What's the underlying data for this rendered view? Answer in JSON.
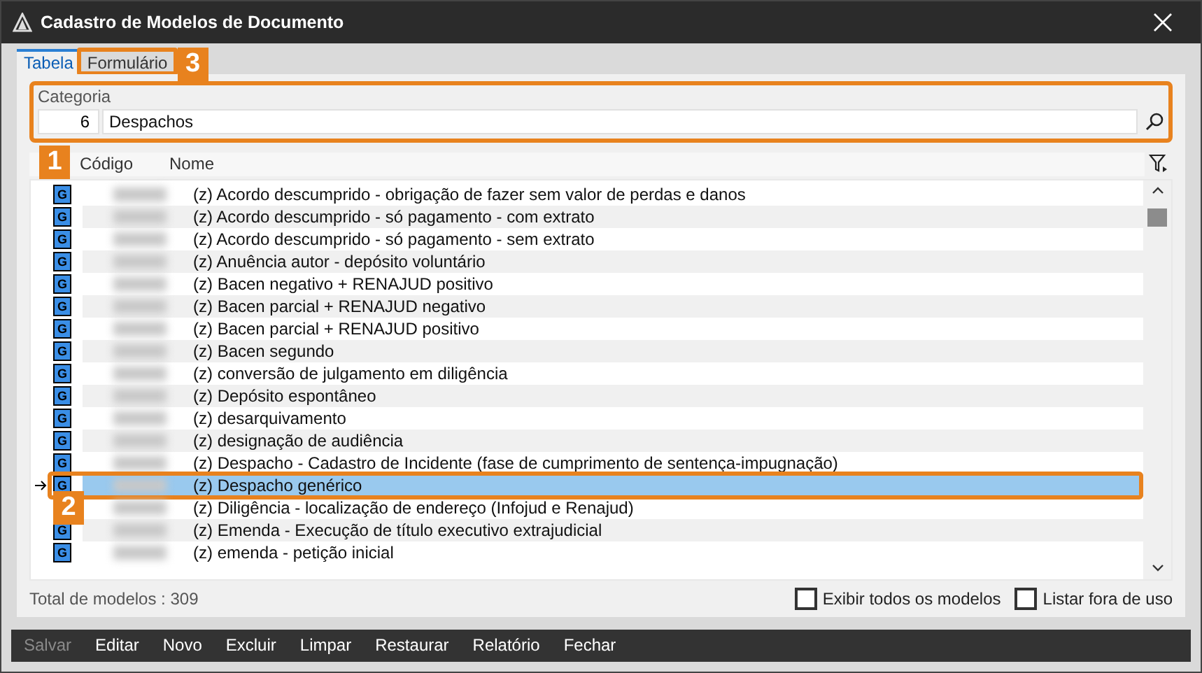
{
  "window": {
    "title": "Cadastro de Modelos de Documento"
  },
  "tabs": [
    {
      "label": "Tabela",
      "selected": true
    },
    {
      "label": "Formulário",
      "selected": false,
      "callout": "3"
    }
  ],
  "category": {
    "label": "Categoria",
    "code": "6",
    "value": "Despachos",
    "callout": "1"
  },
  "table": {
    "columns": [
      "Código",
      "Nome"
    ],
    "rows": [
      {
        "icon": "G",
        "name": "(z) Acordo descumprido - obrigação de fazer sem valor de perdas e danos",
        "selected": false
      },
      {
        "icon": "G",
        "name": "(z) Acordo descumprido - só pagamento - com extrato",
        "selected": false
      },
      {
        "icon": "G",
        "name": "(z) Acordo descumprido - só pagamento - sem extrato",
        "selected": false
      },
      {
        "icon": "G",
        "name": "(z) Anuência autor - depósito voluntário",
        "selected": false
      },
      {
        "icon": "G",
        "name": "(z) Bacen negativo + RENAJUD positivo",
        "selected": false
      },
      {
        "icon": "G",
        "name": "(z) Bacen parcial + RENAJUD negativo",
        "selected": false
      },
      {
        "icon": "G",
        "name": "(z) Bacen parcial + RENAJUD positivo",
        "selected": false
      },
      {
        "icon": "G",
        "name": "(z) Bacen segundo",
        "selected": false
      },
      {
        "icon": "G",
        "name": "(z) conversão de julgamento em diligência",
        "selected": false
      },
      {
        "icon": "G",
        "name": "(z) Depósito espontâneo",
        "selected": false
      },
      {
        "icon": "G",
        "name": "(z) desarquivamento",
        "selected": false
      },
      {
        "icon": "G",
        "name": "(z) designação de audiência",
        "selected": false
      },
      {
        "icon": "G",
        "name": "(z) Despacho - Cadastro de Incidente (fase de cumprimento de sentença-impugnação)",
        "selected": false
      },
      {
        "icon": "G",
        "name": "(z) Despacho genérico",
        "selected": true,
        "callout": "2"
      },
      {
        "name": "(z) Diligência - localização de endereço (Infojud e Renajud)",
        "selected": false
      },
      {
        "icon": "G",
        "name": "(z) Emenda - Execução de título executivo extrajudicial",
        "selected": false
      },
      {
        "icon": "G",
        "name": "(z) emenda - petição inicial",
        "selected": false
      }
    ]
  },
  "total": "Total de modelos : 309",
  "options": [
    {
      "label": "Exibir todos os modelos",
      "checked": false
    },
    {
      "label": "Listar fora de uso",
      "checked": false
    }
  ],
  "toolbar": [
    {
      "label": "Salvar",
      "disabled": true
    },
    {
      "label": "Editar",
      "disabled": false
    },
    {
      "label": "Novo",
      "disabled": false
    },
    {
      "label": "Excluir",
      "disabled": false
    },
    {
      "label": "Limpar",
      "disabled": false
    },
    {
      "label": "Restaurar",
      "disabled": false
    },
    {
      "label": "Relatório",
      "disabled": false
    },
    {
      "label": "Fechar",
      "disabled": false
    }
  ]
}
